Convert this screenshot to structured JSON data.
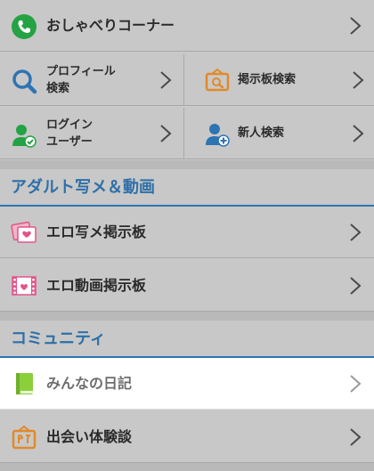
{
  "menu": {
    "chat_corner": {
      "label": "おしゃべりコーナー",
      "icon": "phone-icon"
    },
    "profile_search": {
      "label_line1": "プロフィール",
      "label_line2": "検索",
      "icon": "magnifier-icon"
    },
    "board_search": {
      "label": "掲示板検索",
      "icon": "board-icon"
    },
    "login_users": {
      "label_line1": "ログイン",
      "label_line2": "ユーザー",
      "icon": "user-check-icon"
    },
    "new_search": {
      "label": "新人検索",
      "icon": "user-plus-icon"
    }
  },
  "sections": {
    "adult": {
      "title": "アダルト写メ＆動画",
      "items": [
        {
          "label": "エロ写メ掲示板",
          "icon": "photos-icon"
        },
        {
          "label": "エロ動画掲示板",
          "icon": "film-icon"
        }
      ]
    },
    "community": {
      "title": "コミュニティ",
      "items": [
        {
          "label": "みんなの日記",
          "icon": "book-icon"
        },
        {
          "label": "出会い体験談",
          "icon": "story-icon"
        }
      ]
    }
  },
  "colors": {
    "accent_blue": "#2d74b3",
    "phone_green": "#25a244",
    "book_green": "#8bd03b",
    "pink": "#e2558a",
    "orange": "#e08a2a"
  }
}
